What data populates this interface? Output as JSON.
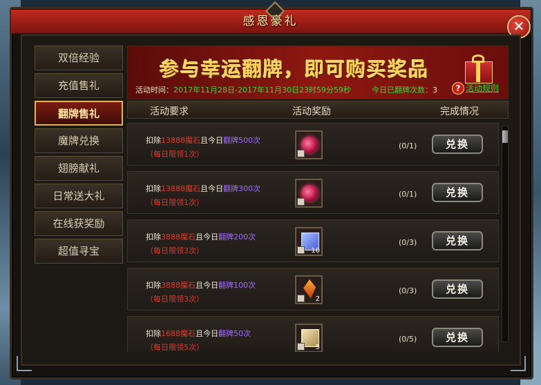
{
  "window": {
    "title": "感恩豪礼",
    "close_icon": "✕"
  },
  "sidebar": {
    "items": [
      {
        "label": "双倍经验",
        "active": false
      },
      {
        "label": "充值售礼",
        "active": false
      },
      {
        "label": "翻牌售礼",
        "active": true
      },
      {
        "label": "魔牌兑换",
        "active": false
      },
      {
        "label": "翅膀献礼",
        "active": false
      },
      {
        "label": "日常送大礼",
        "active": false
      },
      {
        "label": "在线获奖励",
        "active": false
      },
      {
        "label": "超值寻宝",
        "active": false
      }
    ]
  },
  "banner": {
    "title": "参与幸运翻牌，即可购买奖品",
    "time_label": "活动时间：",
    "time_value": "2017年11月28日-2017年11月30日23时59分59秒",
    "count_label": "今日已翻牌次数：",
    "count_value": "3",
    "rules_icon": "?",
    "rules_label": "活动规则"
  },
  "columns": {
    "requirement": "活动要求",
    "reward": "活动奖励",
    "status": "完成情况"
  },
  "rows": [
    {
      "prefix": "扣除",
      "cost": "13888",
      "currency": "魔石",
      "mid": "且今日",
      "cond": "翻牌500次",
      "limit": "（每日限领1次）",
      "item_icon": "red-orb-icon",
      "qty": "",
      "status": "(0/1)",
      "button": "兑换"
    },
    {
      "prefix": "扣除",
      "cost": "13888",
      "currency": "魔石",
      "mid": "且今日",
      "cond": "翻牌300次",
      "limit": "（每日限领1次）",
      "item_icon": "red-orb-icon",
      "qty": "",
      "status": "(0/1)",
      "button": "兑换"
    },
    {
      "prefix": "扣除",
      "cost": "3888",
      "currency": "魔石",
      "mid": "且今日",
      "cond": "翻牌200次",
      "limit": "（每日限领3次）",
      "item_icon": "blue-gift-icon",
      "qty": "10",
      "status": "(0/3)",
      "button": "兑换"
    },
    {
      "prefix": "扣除",
      "cost": "3888",
      "currency": "魔石",
      "mid": "且今日",
      "cond": "翻牌100次",
      "limit": "（每日限领3次）",
      "item_icon": "fire-crystal-icon",
      "qty": "2",
      "status": "(0/3)",
      "button": "兑换"
    },
    {
      "prefix": "扣除",
      "cost": "1688",
      "currency": "魔石",
      "mid": "且今日",
      "cond": "翻牌50次",
      "limit": "（每日限领5次）",
      "item_icon": "gold-gift-icon",
      "qty": "5",
      "status": "(0/5)",
      "button": "兑换"
    }
  ],
  "colors": {
    "accent_red": "#c12a1e",
    "green_text": "#34d83a",
    "purple_text": "#a36cff",
    "cost_red": "#e23a2a",
    "gold_title": "#ffd35a"
  }
}
